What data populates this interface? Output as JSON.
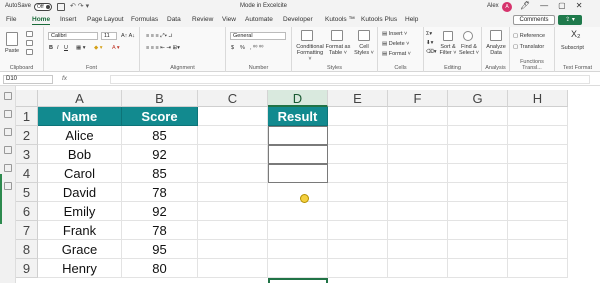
{
  "titlebar": {
    "autosave_label": "AutoSave",
    "autosave_state": "Off",
    "document_title": "Mode in Excelcite",
    "user_name": "Alex",
    "user_initial": "A"
  },
  "tabs": [
    "File",
    "Home",
    "Insert",
    "Page Layout",
    "Formulas",
    "Data",
    "Review",
    "View",
    "Automate",
    "Developer",
    "Kutools ™",
    "Kutools Plus",
    "Help"
  ],
  "active_tab": "Home",
  "header_buttons": {
    "comments": "Comments"
  },
  "ribbon": {
    "clipboard": {
      "label": "Clipboard",
      "paste": "Paste"
    },
    "font": {
      "label": "Font",
      "font_name": "Calibri",
      "font_size": "11",
      "bold": "B",
      "italic": "I",
      "underline": "U"
    },
    "alignment": {
      "label": "Alignment"
    },
    "number": {
      "label": "Number",
      "format": "General",
      "currency": "$",
      "percent": "%"
    },
    "styles": {
      "label": "Styles",
      "conditional": "Conditional Formatting ˅",
      "format_table": "Format as Table ˅",
      "cell_styles": "Cell Styles ˅"
    },
    "cells": {
      "label": "Cells",
      "insert": "Insert ˅",
      "delete": "Delete ˅",
      "format": "Format ˅"
    },
    "editing": {
      "label": "Editing",
      "sort": "Sort & Filter ˅",
      "find": "Find & Select ˅"
    },
    "analysis": {
      "label": "Analysis",
      "analyze": "Analyze Data"
    },
    "functions": {
      "label": "Functions Transl...",
      "reference": "Reference",
      "translator": "Translator"
    },
    "textformat": {
      "label": "Text Format",
      "subscript": "Subscript"
    }
  },
  "formula_bar": {
    "name_box": "D10",
    "fx": "fx",
    "value": ""
  },
  "columns": [
    "A",
    "B",
    "C",
    "D",
    "E",
    "F",
    "G",
    "H"
  ],
  "rows": [
    "1",
    "2",
    "3",
    "4",
    "5",
    "6",
    "7",
    "8",
    "9"
  ],
  "table": {
    "headers": [
      "Name",
      "Score"
    ],
    "data": [
      [
        "Alice",
        "85"
      ],
      [
        "Bob",
        "92"
      ],
      [
        "Carol",
        "85"
      ],
      [
        "David",
        "78"
      ],
      [
        "Emily",
        "92"
      ],
      [
        "Frank",
        "78"
      ],
      [
        "Grace",
        "95"
      ],
      [
        "Henry",
        "80"
      ]
    ]
  },
  "result": {
    "header": "Result"
  },
  "colors": {
    "accent": "#217346",
    "table_header": "#128a8f"
  }
}
